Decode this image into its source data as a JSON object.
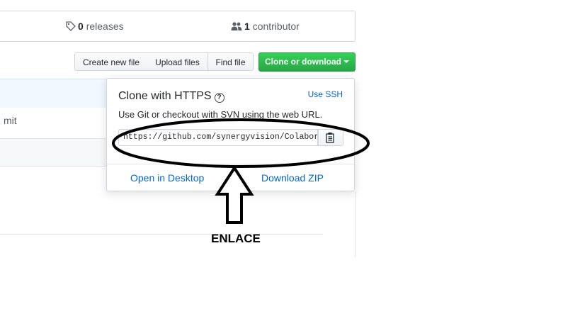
{
  "summary": {
    "releases_count": "0",
    "releases_label": "releases",
    "contributors_count": "1",
    "contributors_label": "contributor"
  },
  "toolbar": {
    "create_file": "Create new file",
    "upload_files": "Upload files",
    "find_file": "Find file",
    "clone_download": "Clone or download"
  },
  "background": {
    "commit_fragment": "mit"
  },
  "clone_popup": {
    "title": "Clone with HTTPS",
    "use_ssh": "Use SSH",
    "description": "Use Git or checkout with SVN using the web URL.",
    "url": "https://github.com/synergyvision/Colabora",
    "open_desktop": "Open in Desktop",
    "download_zip": "Download ZIP"
  },
  "annotation": {
    "label": "ENLACE"
  },
  "colors": {
    "primary_green": "#28a745",
    "link_blue": "#0366d6"
  }
}
